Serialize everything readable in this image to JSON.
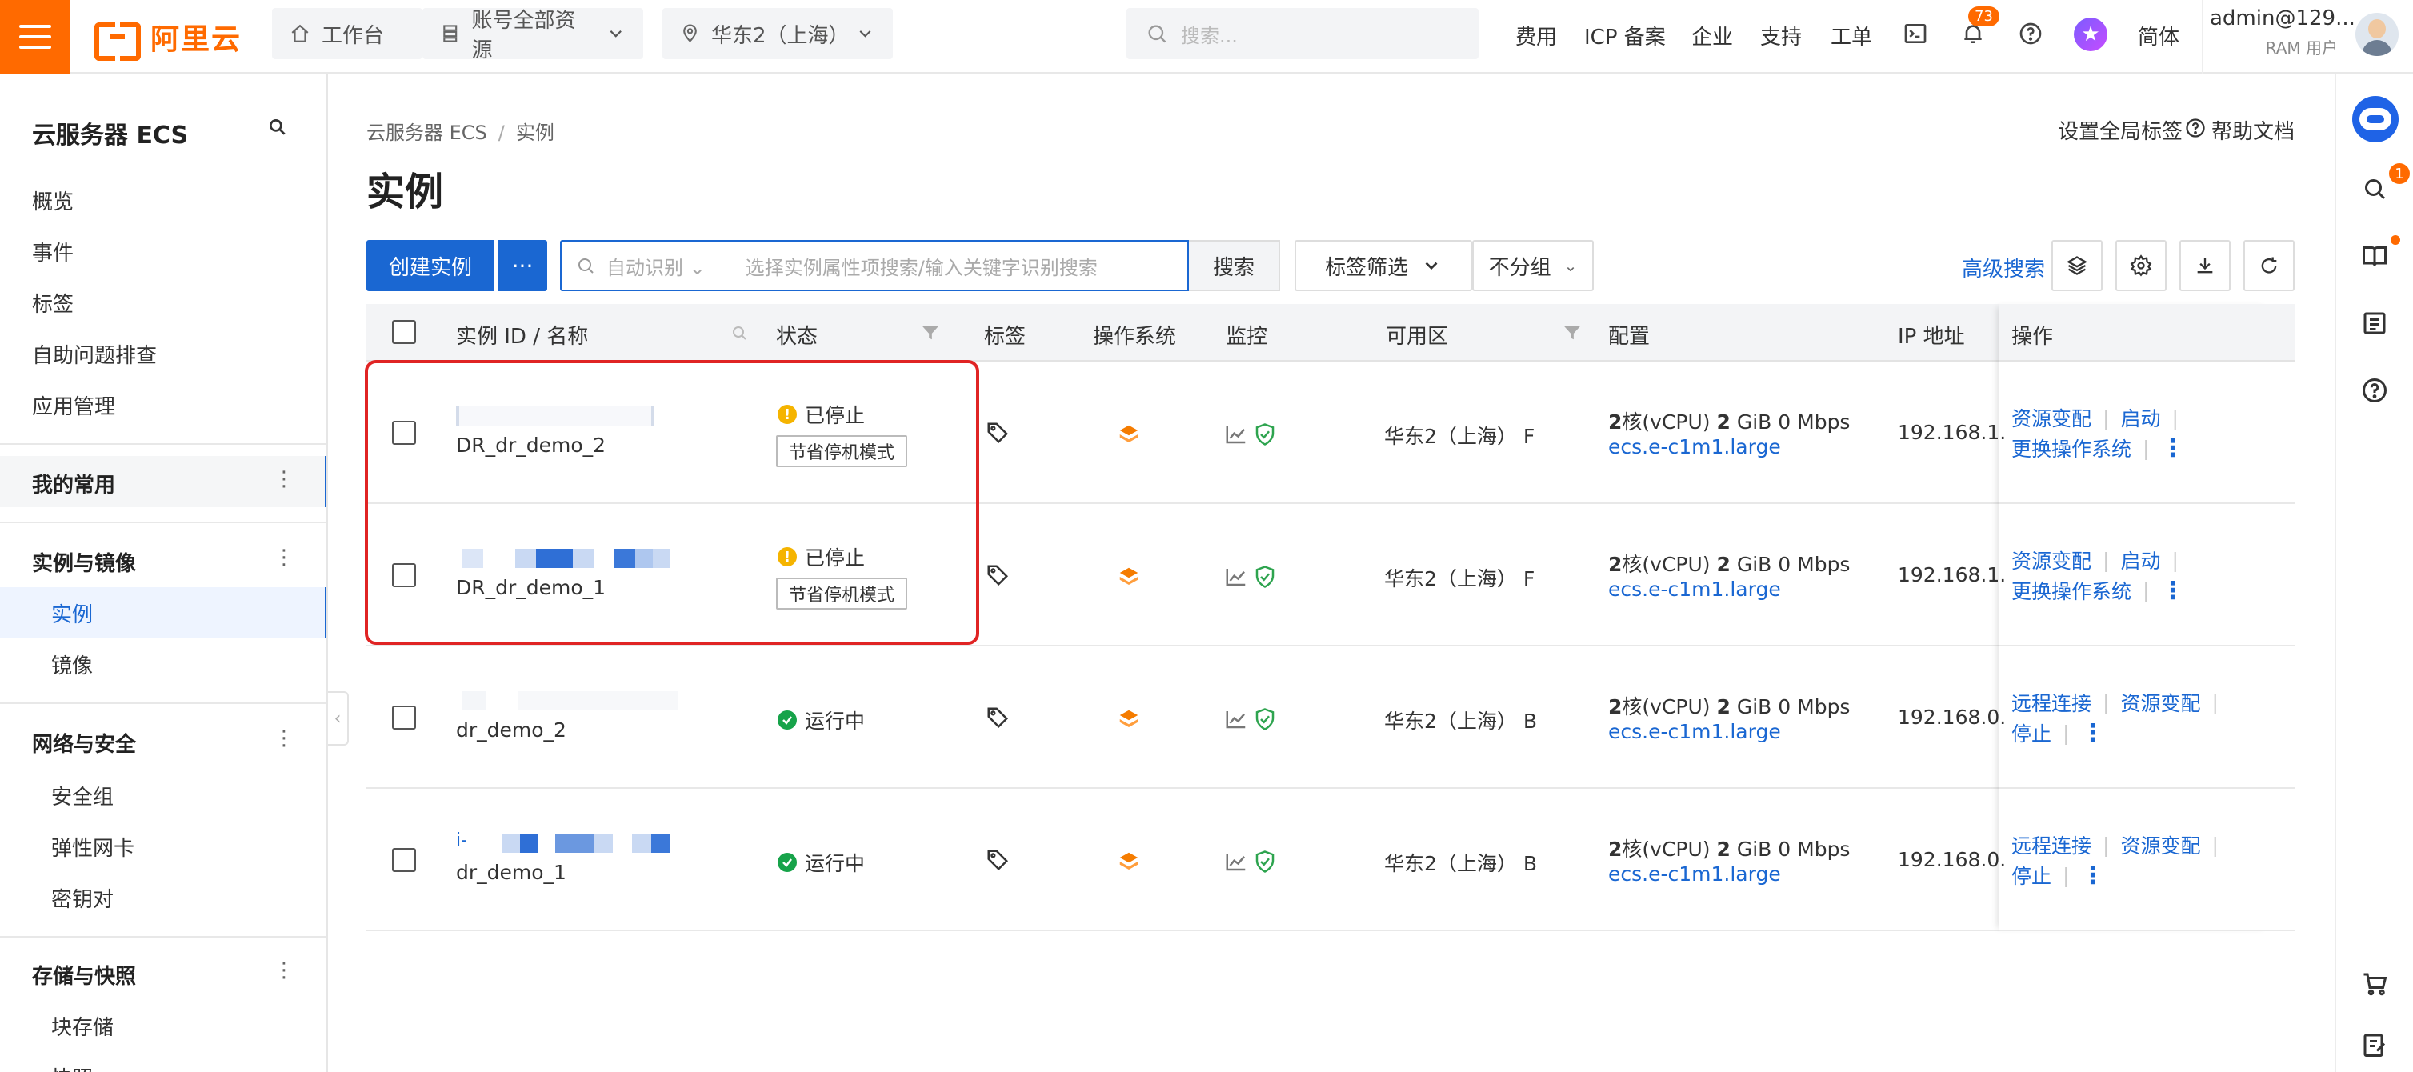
{
  "topbar": {
    "logo_text": "阿里云",
    "workbench": "工作台",
    "resources": "账号全部资源",
    "region": "华东2（上海）",
    "search_placeholder": "搜索...",
    "nav": [
      "费用",
      "ICP 备案",
      "企业",
      "支持",
      "工单"
    ],
    "notification_count": "73",
    "language": "简体",
    "user_name": "admin@129...",
    "user_role": "RAM 用户"
  },
  "sidebar": {
    "title": "云服务器 ECS",
    "top_items": [
      "概览",
      "事件",
      "标签",
      "自助问题排查",
      "应用管理"
    ],
    "favorites": "我的常用",
    "groups": [
      {
        "label": "实例与镜像",
        "items": [
          "实例",
          "镜像"
        ]
      },
      {
        "label": "网络与安全",
        "items": [
          "安全组",
          "弹性网卡",
          "密钥对"
        ]
      },
      {
        "label": "存储与快照",
        "items": [
          "块存储",
          "快照"
        ]
      }
    ]
  },
  "main": {
    "breadcrumb": [
      "云服务器 ECS",
      "实例"
    ],
    "title": "实例",
    "set_global_tags": "设置全局标签",
    "help_docs": "帮助文档",
    "create_button": "创建实例",
    "more_button": "···",
    "auto_detect": "自动识别",
    "filter_placeholder": "选择实例属性项搜索/输入关键字识别搜索",
    "search_button": "搜索",
    "tag_filter": "标签筛选",
    "no_group": "不分组",
    "advanced_search": "高级搜索"
  },
  "table": {
    "columns": [
      "实例 ID / 名称",
      "状态",
      "标签",
      "操作系统",
      "监控",
      "可用区",
      "配置",
      "IP 地址",
      "操作"
    ],
    "rows": [
      {
        "id_prefix": "",
        "name": "DR_dr_demo_2",
        "status": "已停止",
        "status_type": "stopped",
        "stop_mode": "节省停机模式",
        "zone": "华东2（上海） F",
        "spec_cpu": "2",
        "spec_cpu_unit": "核(vCPU)",
        "spec_mem": "2",
        "spec_mem_unit": "GiB 0 Mbps",
        "instance_type": "ecs.e-c1m1.large",
        "ip": "192.168.1.",
        "ops": [
          "资源变配",
          "启动",
          "更换操作系统"
        ]
      },
      {
        "id_prefix": "",
        "name": "DR_dr_demo_1",
        "status": "已停止",
        "status_type": "stopped",
        "stop_mode": "节省停机模式",
        "zone": "华东2（上海） F",
        "spec_cpu": "2",
        "spec_cpu_unit": "核(vCPU)",
        "spec_mem": "2",
        "spec_mem_unit": "GiB 0 Mbps",
        "instance_type": "ecs.e-c1m1.large",
        "ip": "192.168.1.",
        "ops": [
          "资源变配",
          "启动",
          "更换操作系统"
        ]
      },
      {
        "id_prefix": "",
        "name": "dr_demo_2",
        "status": "运行中",
        "status_type": "running",
        "stop_mode": "",
        "zone": "华东2（上海） B",
        "spec_cpu": "2",
        "spec_cpu_unit": "核(vCPU)",
        "spec_mem": "2",
        "spec_mem_unit": "GiB 0 Mbps",
        "instance_type": "ecs.e-c1m1.large",
        "ip": "192.168.0.",
        "ops": [
          "远程连接",
          "资源变配",
          "停止"
        ]
      },
      {
        "id_prefix": "i-",
        "name": "dr_demo_1",
        "status": "运行中",
        "status_type": "running",
        "stop_mode": "",
        "zone": "华东2（上海） B",
        "spec_cpu": "2",
        "spec_cpu_unit": "核(vCPU)",
        "spec_mem": "2",
        "spec_mem_unit": "GiB 0 Mbps",
        "instance_type": "ecs.e-c1m1.large",
        "ip": "192.168.0.",
        "ops": [
          "远程连接",
          "资源变配",
          "停止"
        ]
      }
    ]
  },
  "rail": {
    "search_badge": "1"
  },
  "colors": {
    "brand": "#ff6a00",
    "primary": "#1a67d2",
    "highlight": "#e02424",
    "running": "#17a34a",
    "stopped": "#f5b400"
  }
}
